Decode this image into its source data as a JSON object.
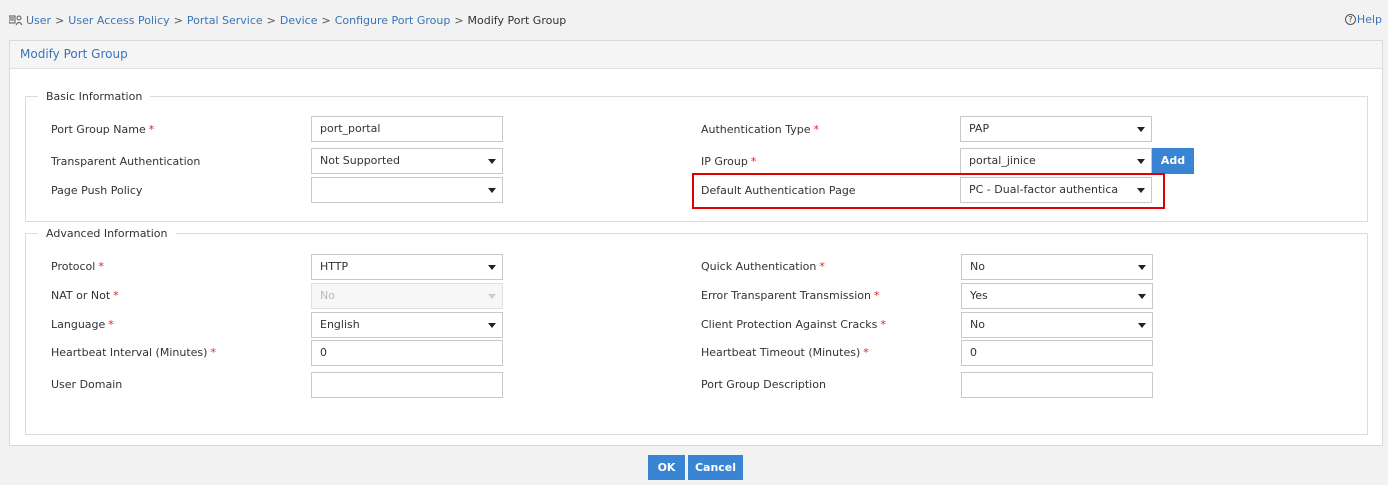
{
  "breadcrumb": {
    "items": [
      "User",
      "User Access Policy",
      "Portal Service",
      "Device",
      "Configure Port Group"
    ],
    "current": "Modify Port Group",
    "separator": ">"
  },
  "help": {
    "label": "Help"
  },
  "panel": {
    "title": "Modify Port Group"
  },
  "basic": {
    "legend": "Basic Information",
    "port_group_name": {
      "label": "Port Group Name",
      "value": "port_portal",
      "required": "*"
    },
    "transparent_auth": {
      "label": "Transparent Authentication",
      "value": "Not Supported"
    },
    "page_push_policy": {
      "label": "Page Push Policy",
      "value": ""
    },
    "auth_type": {
      "label": "Authentication Type",
      "value": "PAP",
      "required": "*"
    },
    "ip_group": {
      "label": "IP Group",
      "value": "portal_jinice",
      "required": "*",
      "add_label": "Add"
    },
    "default_auth_page": {
      "label": "Default Authentication Page",
      "value": "PC - Dual-factor authentica"
    }
  },
  "advanced": {
    "legend": "Advanced Information",
    "protocol": {
      "label": "Protocol",
      "value": "HTTP",
      "required": "*"
    },
    "nat": {
      "label": "NAT or Not",
      "value": "No",
      "required": "*"
    },
    "language": {
      "label": "Language",
      "value": "English",
      "required": "*"
    },
    "heartbeat_interval": {
      "label": "Heartbeat Interval (Minutes)",
      "value": "0",
      "required": "*"
    },
    "user_domain": {
      "label": "User Domain",
      "value": ""
    },
    "quick_auth": {
      "label": "Quick Authentication",
      "value": "No",
      "required": "*"
    },
    "error_transparent": {
      "label": "Error Transparent Transmission",
      "value": "Yes",
      "required": "*"
    },
    "client_protection": {
      "label": "Client Protection Against Cracks",
      "value": "No",
      "required": "*"
    },
    "heartbeat_timeout": {
      "label": "Heartbeat Timeout (Minutes)",
      "value": "0",
      "required": "*"
    },
    "port_group_desc": {
      "label": "Port Group Description",
      "value": ""
    }
  },
  "actions": {
    "ok_label": "OK",
    "cancel_label": "Cancel"
  },
  "colors": {
    "accent": "#3a84d4",
    "link": "#3a74b8",
    "required": "#e02020",
    "highlight": "#e00000"
  }
}
